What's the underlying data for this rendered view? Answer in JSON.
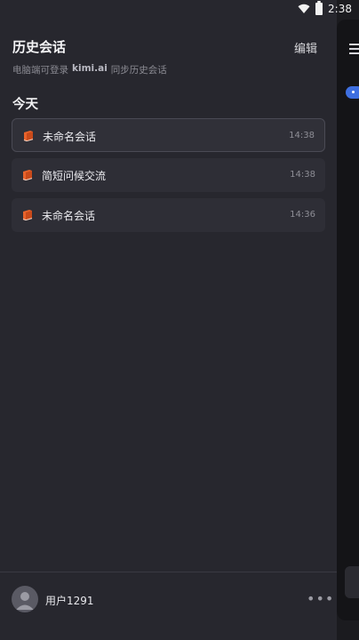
{
  "status_bar": {
    "time": "2:38"
  },
  "sidebar": {
    "title": "历史会话",
    "edit_label": "编辑",
    "sync_prefix": "电脑端可登录",
    "sync_site": "kimi.ai",
    "sync_suffix": "同步历史会话",
    "section_today": "今天",
    "chats": [
      {
        "title": "未命名会话",
        "time": "14:38",
        "active": true
      },
      {
        "title": "简短问候交流",
        "time": "14:38",
        "active": false
      },
      {
        "title": "未命名会话",
        "time": "14:36",
        "active": false
      }
    ],
    "user": {
      "name": "用户1291"
    }
  },
  "colors": {
    "drawer_bg": "#27272e",
    "item_bg": "#2e2e36",
    "accent_blue": "#3e6fe0",
    "icon_orange": "#e8632b"
  },
  "icons": [
    "wifi-icon",
    "battery-icon",
    "book-icon",
    "avatar-icon",
    "more-icon",
    "menu-icon"
  ]
}
